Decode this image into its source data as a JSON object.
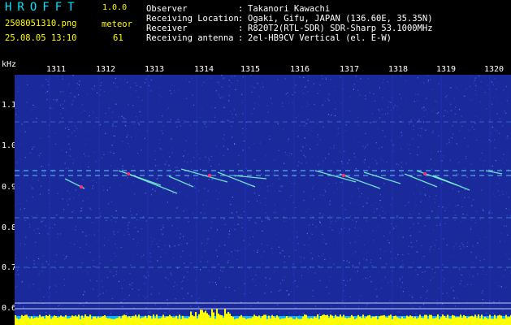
{
  "header": {
    "app_title": "HROFFT",
    "app_version": "1.0.0",
    "filename": "2508051310.png",
    "timestamp": "25.08.05 13:10",
    "meteor_label": "meteor",
    "meteor_count": "61"
  },
  "info": [
    {
      "key": "Observer",
      "value": "Takanori Kawachi"
    },
    {
      "key": "Receiving Location",
      "value": "Ogaki, Gifu, JAPAN (136.60E, 35.35N)"
    },
    {
      "key": "Receiver",
      "value": "R820T2(RTL-SDR) SDR-Sharp 53.1000MHz"
    },
    {
      "key": "Receiving antenna",
      "value": "2el-HB9CV Vertical (el. E-W)"
    }
  ],
  "axis": {
    "y_unit": "kHz",
    "y_ticks": [
      "1.1",
      "1.0",
      "0.9",
      "0.8",
      "0.7",
      "0.6"
    ],
    "x_ticks": [
      "1311",
      "1312",
      "1313",
      "1314",
      "1315",
      "1316",
      "1317",
      "1318",
      "1319",
      "1320"
    ]
  },
  "colors": {
    "background": "#1a2a9a",
    "noise": "#3a58ff",
    "carrier": "#6ad0ff",
    "meteor": "#7fffd4",
    "meteor_hot": "#ff3070",
    "signal_bar": "#ffff00",
    "bottom_band": "#00b8ff",
    "title": "#00e5ff",
    "label": "#fffb00"
  }
}
